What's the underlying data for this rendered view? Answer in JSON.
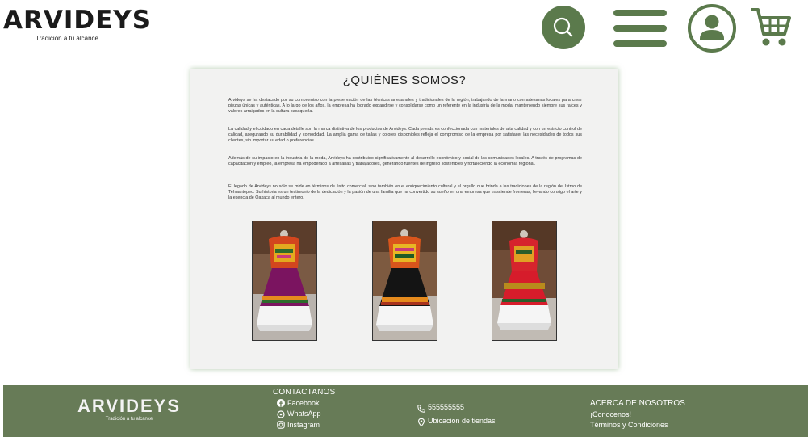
{
  "header": {
    "logo_text": "ARVIDEYS",
    "logo_tagline": "Tradición a tu alcance",
    "icons": [
      "search-icon",
      "menu-icon",
      "user-icon",
      "cart-icon"
    ],
    "accent_color": "#5b7a4c"
  },
  "about": {
    "title": "¿QUIÉNES SOMOS?",
    "paragraphs": [
      "Arvideys se ha destacado por su compromiso con la preservación de las técnicas artesanales y tradicionales de la región, trabajando de la mano con artesanas locales para crear piezas únicas y auténticas. A lo largo de los años, la empresa ha logrado expandirse y consolidarse como un referente en la industria de la moda, manteniendo siempre sus raíces y valores arraigados en la cultura oaxaqueña.",
      "La calidad y el cuidado en cada detalle son la marca distintiva de los productos de Arvideys. Cada prenda es confeccionada con materiales de alta calidad y con un estricto control de calidad, asegurando su durabilidad y comodidad. La amplia gama de tallas y colores disponibles refleja el compromiso de la empresa por satisfacer las necesidades de todos sus clientes, sin importar su edad o preferencias.",
      "Además de su impacto en la industria de la moda, Arvideys ha contribuido significativamente al desarrollo económico y social de las comunidades locales. A través de programas de capacitación y empleo, la empresa ha empoderado a artesanas y trabajadores, generando fuentes de ingreso sostenibles y fortaleciendo la economía regional.",
      "El legado de Arvideys no sólo se mide en términos de éxito comercial, sino también en el enriquecimiento cultural y el orgullo que brinda a las tradiciones de la región del Istmo de Tehuantepec. Su historia es un testimonio de la dedicación y la pasión de una familia que ha convertido su sueño en una empresa que trasciende fronteras, llevando consigo el arte y la esencia de Oaxaca al mundo entero."
    ],
    "photos": [
      "purple-huipil-dress",
      "black-huipil-dress",
      "red-huipil-dress"
    ]
  },
  "footer": {
    "logo_text": "ARVIDEYS",
    "logo_tagline": "Tradición a tu alcance",
    "contact_heading": "CONTACTANOS",
    "facebook": "Facebook",
    "whatsapp": "WhatsApp",
    "instagram": "Instagram",
    "phone": "555555555",
    "stores": "Ubicacion de tiendas",
    "about_heading": "ACERCA DE NOSOTROS",
    "about_link": "¡Conocenos!",
    "terms_link": "Términos y Condiciones",
    "background_color": "#677b57"
  }
}
